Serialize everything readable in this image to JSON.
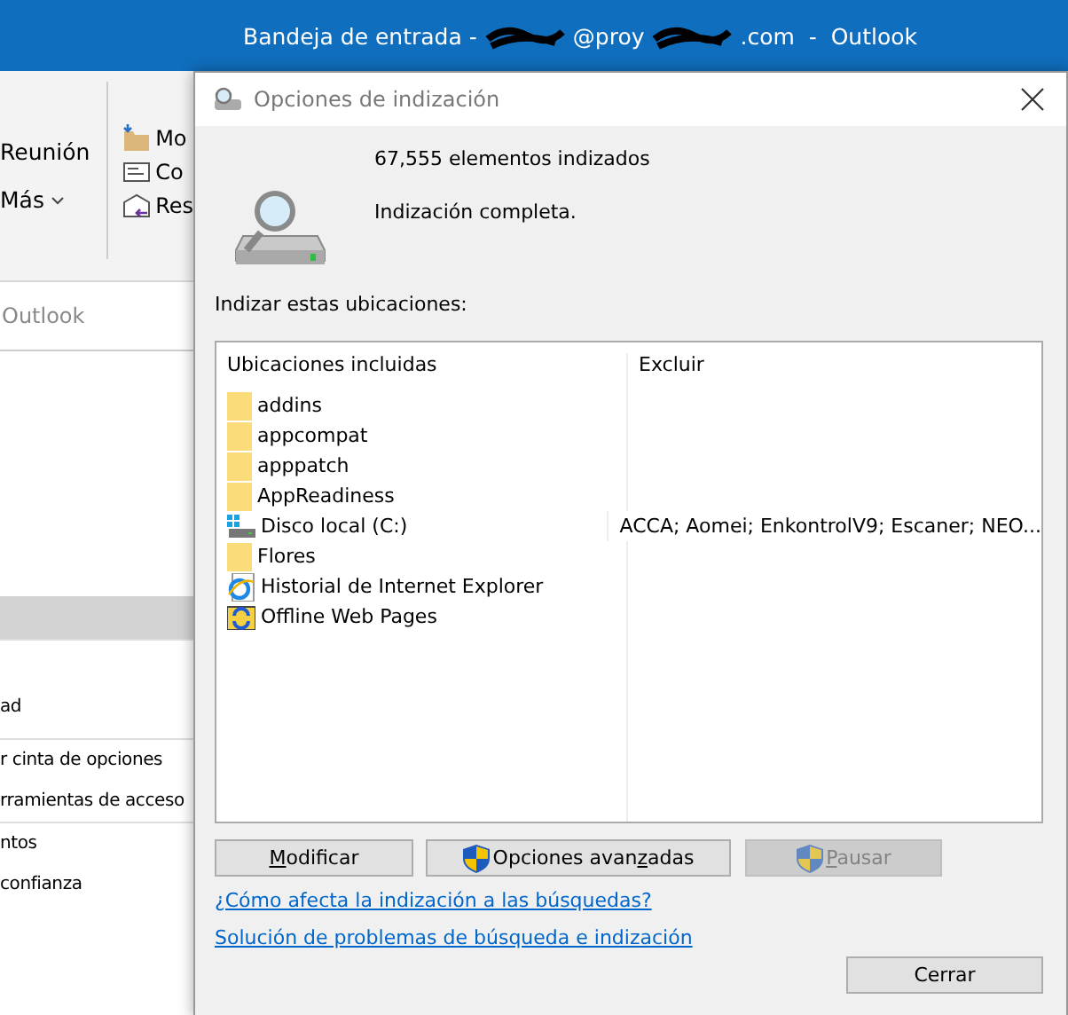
{
  "outlook_title": {
    "segments": [
      "Bandeja de entrada -",
      "@proy",
      ".com  -  Outlook"
    ]
  },
  "ribbon": {
    "left_items": [
      {
        "label": "Reunión",
        "caret": false
      },
      {
        "label": "Más",
        "caret": true
      }
    ],
    "small_items": [
      {
        "kind": "move",
        "label": "Mo"
      },
      {
        "kind": "card",
        "label": "Co"
      },
      {
        "kind": "reply",
        "label": "Res"
      }
    ]
  },
  "search": {
    "placeholder": "Outlook"
  },
  "left_sections": [
    [
      "ad"
    ],
    [
      "r cinta de opciones",
      "rramientas de acceso"
    ],
    [
      "ntos",
      "confianza"
    ]
  ],
  "dialog": {
    "title": "Opciones de indización",
    "count": "67,555 elementos indizados",
    "state": "Indización completa.",
    "section_label": "Indizar estas ubicaciones:",
    "columns": [
      "Ubicaciones incluidas",
      "Excluir"
    ],
    "locations": [
      {
        "kind": "folder",
        "name": "addins"
      },
      {
        "kind": "folder",
        "name": "appcompat"
      },
      {
        "kind": "folder",
        "name": "apppatch"
      },
      {
        "kind": "folder",
        "name": "AppReadiness"
      },
      {
        "kind": "disk",
        "name": "Disco local (C:)",
        "exclude": "ACCA; Aomei; EnkontrolV9; Escaner; NEO..."
      },
      {
        "kind": "folder",
        "name": "Flores"
      },
      {
        "kind": "browser",
        "name": "Historial de Internet Explorer"
      },
      {
        "kind": "offline",
        "name": "Offline Web Pages"
      }
    ],
    "buttons": [
      {
        "access_key": "M",
        "label_rest": "odificar",
        "shield": false,
        "disabled": false
      },
      {
        "label_start": "Opciones avan",
        "access_key": "z",
        "label_rest": "adas",
        "shield": true,
        "disabled": false
      },
      {
        "access_key": "P",
        "label_rest": "ausar",
        "shield": true,
        "disabled": true
      }
    ],
    "links": [
      "¿Cómo afecta la indización a las búsquedas?",
      "Solución de problemas de búsqueda e indización"
    ],
    "close_button": "Cerrar"
  }
}
